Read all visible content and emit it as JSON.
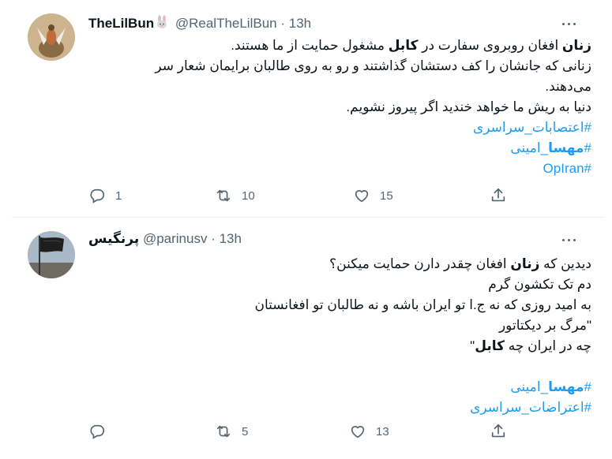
{
  "tweets": [
    {
      "name": "TheLilBun",
      "name_emoji": "rabbit-icon",
      "handle": "@RealTheLilBun",
      "time": "13h",
      "lines": [
        [
          {
            "t": "زنان",
            "b": true
          },
          {
            "t": " افغان روبروی سفارت در "
          },
          {
            "t": "کابل",
            "b": true
          },
          {
            "t": " مشغول حمایت از ما هستند."
          }
        ],
        [
          {
            "t": "زنانی که جانشان را کف دستشان گذاشتند و رو به روی طالبان برایمان شعار سر"
          }
        ],
        [
          {
            "t": "می‌دهند."
          }
        ],
        [
          {
            "t": "دنیا به ریش ما خواهد خندید اگر پیروز نشویم."
          }
        ],
        [
          {
            "t": "#اعتصابات_سراسری",
            "h": true
          }
        ],
        [
          {
            "t": "#",
            "h": true
          },
          {
            "t": "مهسا",
            "h": true,
            "b": true
          },
          {
            "t": "_امینی",
            "h": true
          }
        ],
        [
          {
            "t": "#OpIran",
            "h": true
          }
        ]
      ],
      "replies": "1",
      "retweets": "10",
      "likes": "15"
    },
    {
      "name": "پرنگیس",
      "handle": "@parinusv",
      "time": "13h",
      "lines": [
        [
          {
            "t": "دیدین که "
          },
          {
            "t": "زنان",
            "b": true
          },
          {
            "t": " افغان چقدر دارن حمایت میکنن؟"
          }
        ],
        [
          {
            "t": "دم تک تکشون گرم"
          }
        ],
        [
          {
            "t": "به امید روزی که نه ج.ا تو ایران باشه و نه طالبان تو افغانستان"
          }
        ],
        [
          {
            "t": "\"مرگ بر دیکتاتور"
          }
        ],
        [
          {
            "t": "چه در ایران چه "
          },
          {
            "t": "کابل",
            "b": true
          },
          {
            "t": "\""
          }
        ],
        [],
        [
          {
            "t": "#",
            "h": true
          },
          {
            "t": "مهسا",
            "h": true,
            "b": true
          },
          {
            "t": "_امینی",
            "h": true
          }
        ],
        [
          {
            "t": "#اعتراضات_سراسری",
            "h": true
          }
        ]
      ],
      "replies": "",
      "retweets": "5",
      "likes": "13"
    }
  ],
  "icons": {
    "reply": "reply-icon",
    "retweet": "retweet-icon",
    "like": "like-icon",
    "share": "share-icon",
    "more": "more-icon"
  },
  "colors": {
    "link": "#1d9bf0",
    "muted": "#536471",
    "text": "#0f1419",
    "divider": "#eff3f4"
  }
}
